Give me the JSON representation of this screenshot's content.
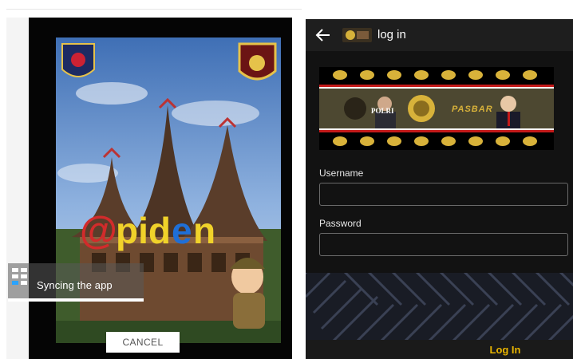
{
  "splash": {
    "logo_text": "@piden",
    "sync_status": "Syncing the app",
    "cancel_label": "CANCEL",
    "sync_icon": "grid-icon"
  },
  "login": {
    "title": "log in",
    "back_icon": "arrow-left-icon",
    "banner_left_text": "POLRI",
    "banner_right_text": "PASBAR",
    "username_label": "Username",
    "username_value": "",
    "password_label": "Password",
    "password_value": "",
    "submit_label": "Log In",
    "colors": {
      "accent": "#e8b400",
      "background": "#121212"
    }
  }
}
